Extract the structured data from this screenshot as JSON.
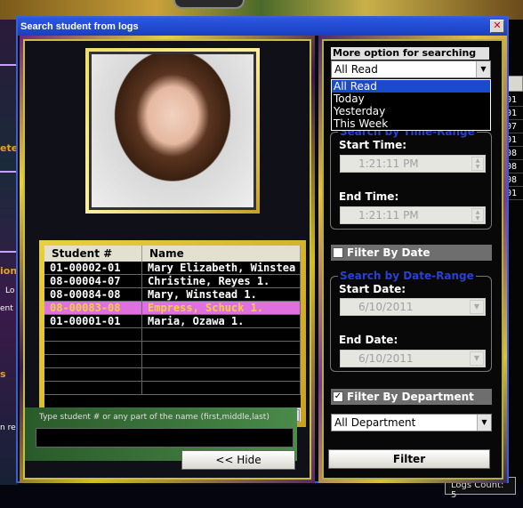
{
  "background_app": {
    "left_fragments": [
      "ete",
      "ion",
      "Lo",
      "ent",
      "s",
      "n re"
    ],
    "right_cells": [
      "01",
      "01",
      "07",
      "01",
      "08",
      "08",
      "08",
      "01"
    ],
    "logs_label": "Logs Count: 5"
  },
  "dialog": {
    "title": "Search student from logs",
    "close_icon": "close-icon"
  },
  "grid": {
    "columns": [
      "Student #",
      "Name"
    ],
    "rows": [
      {
        "id": "01-00002-01",
        "name": "Mary Elizabeth, Winstea",
        "selected": false
      },
      {
        "id": "08-00004-07",
        "name": "Christine, Reyes 1.",
        "selected": false
      },
      {
        "id": "08-00084-08",
        "name": "Mary, Winstead 1.",
        "selected": false
      },
      {
        "id": "08-00083-08",
        "name": "Empress, Schuck 1.",
        "selected": true
      },
      {
        "id": "01-00001-01",
        "name": "Maria, Ozawa 1.",
        "selected": false
      }
    ],
    "scroll_thumb_glyph": "|||"
  },
  "search": {
    "hint": "Type student # or any part of the name (first,middle,last)",
    "value": "",
    "hide_label": "<< Hide"
  },
  "options": {
    "more_label": "More option for searching",
    "selected": "All Read",
    "dropdown_items": [
      "All Read",
      "Today",
      "Yesterday",
      "This Week"
    ],
    "time_range": {
      "title": "Search by Time-Range",
      "start_label": "Start Time:",
      "start_value": "1:21:11 PM",
      "end_label": "End Time:",
      "end_value": "1:21:11 PM"
    },
    "filter_by_date": {
      "label": "Filter By Date",
      "checked": false
    },
    "date_range": {
      "title": "Search by Date-Range",
      "start_label": "Start Date:",
      "start_value": "6/10/2011",
      "end_label": "End Date:",
      "end_value": "6/10/2011"
    },
    "filter_by_department": {
      "label": "Filter By Department",
      "checked": true,
      "check_glyph": "✓"
    },
    "department_value": "All Department",
    "filter_label": "Filter"
  },
  "colors": {
    "titlebar": "#2b57e0",
    "selected_row_bg": "#e070e0",
    "selected_row_text": "#f0d040",
    "group_title": "#2a40d0",
    "dropdown_highlight": "#1a4ad0"
  }
}
